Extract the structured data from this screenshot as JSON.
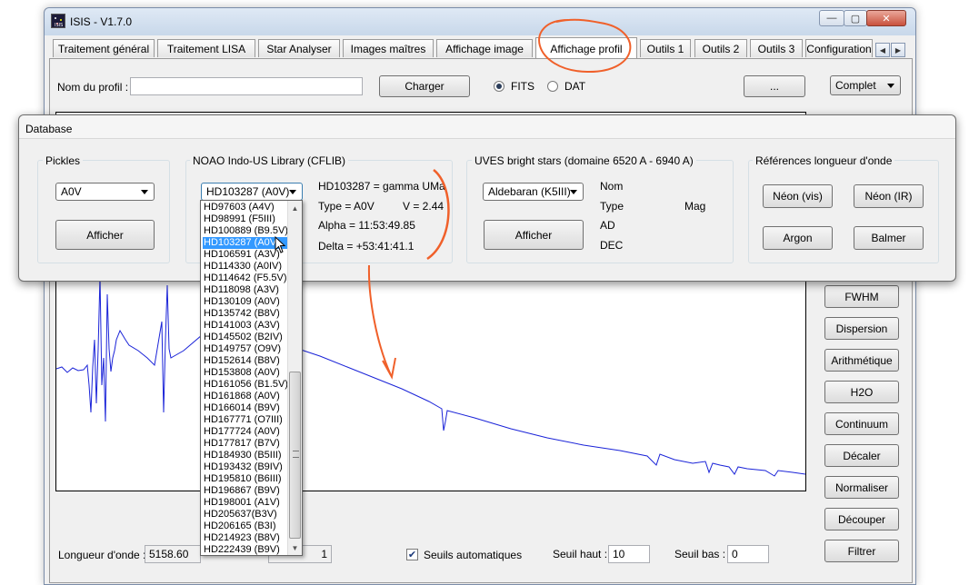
{
  "window": {
    "title": "ISIS - V1.7.0",
    "icon": "isis-app-icon",
    "controls": [
      "—",
      "▢",
      "✕"
    ]
  },
  "tabs": [
    {
      "label": "Traitement général",
      "active": false
    },
    {
      "label": "Traitement LISA",
      "active": false
    },
    {
      "label": "Star Analyser",
      "active": false
    },
    {
      "label": "Images maîtres",
      "active": false
    },
    {
      "label": "Affichage image",
      "active": false
    },
    {
      "label": "Affichage profil",
      "active": true
    },
    {
      "label": "Outils 1",
      "active": false
    },
    {
      "label": "Outils 2",
      "active": false
    },
    {
      "label": "Outils 3",
      "active": false
    },
    {
      "label": "Configuration",
      "active": false
    }
  ],
  "tab_scroll": {
    "left": "◀",
    "right": "▶"
  },
  "profile": {
    "name_label": "Nom du profil :",
    "name_value": "",
    "load_button": "Charger",
    "format_fits": "FITS",
    "format_dat": "DAT",
    "selected_format": "FITS",
    "browse_button": "...",
    "mode_value": "Complet"
  },
  "side_buttons": [
    "FWHM",
    "Dispersion",
    "Arithmétique",
    "H2O",
    "Continuum",
    "Décaler",
    "Normaliser",
    "Découper",
    "Filtrer"
  ],
  "bottom": {
    "wavelength_label": "Longueur d'onde :",
    "wavelength_value": "5158.60",
    "second_value": "1",
    "auto_thresholds_label": "Seuils automatiques",
    "auto_thresholds_checked": true,
    "high_label": "Seuil haut :",
    "high_value": "10",
    "low_label": "Seuil bas :",
    "low_value": "0"
  },
  "database": {
    "title": "Database",
    "pickles": {
      "title": "Pickles",
      "selected": "A0V",
      "show_button": "Afficher"
    },
    "noao": {
      "title": "NOAO Indo-US Library (CFLIB)",
      "selected": "HD103287 (A0V)",
      "star_name": "HD103287 = gamma UMa",
      "type": "Type = A0V",
      "magnitude": "V = 2.44",
      "alpha": "Alpha = 11:53:49.85",
      "delta": "Delta = +53:41:41.1",
      "list": [
        "HD97603 (A4V)",
        "HD98991 (F5III)",
        "HD100889 (B9.5V)",
        "HD103287 (A0V)",
        "HD106591 (A3V)",
        "HD114330 (A0IV)",
        "HD114642 (F5.5V)",
        "HD118098 (A3V)",
        "HD130109 (A0V)",
        "HD135742 (B8V)",
        "HD141003 (A3V)",
        "HD145502 (B2IV)",
        "HD149757 (O9V)",
        "HD152614 (B8V)",
        "HD153808 (A0V)",
        "HD161056 (B1.5V)",
        "HD161868 (A0V)",
        "HD166014 (B9V)",
        "HD167771 (O7III)",
        "HD177724 (A0V)",
        "HD177817 (B7V)",
        "HD184930 (B5III)",
        "HD193432 (B9IV)",
        "HD195810 (B6III)",
        "HD196867 (B9V)",
        "HD198001 (A1V)",
        "HD205637(B3V)",
        "HD206165 (B3I)",
        "HD214923 (B8V)",
        "HD222439 (B9V)"
      ],
      "selected_index": 3
    },
    "uves": {
      "title": "UVES bright stars (domaine 6520 A - 6940 A)",
      "selected": "Aldebaran (K5III)",
      "show_button": "Afficher",
      "nom_label": "Nom",
      "type_label": "Type",
      "mag_label": "Mag",
      "ad_label": "AD",
      "dec_label": "DEC"
    },
    "refs": {
      "title": "Références longueur d'onde",
      "neon_vis": "Néon (vis)",
      "neon_ir": "Néon (IR)",
      "argon": "Argon",
      "balmer": "Balmer"
    }
  },
  "colors": {
    "spectrum": "#1a23d8",
    "annotation": "#f0602a",
    "selection": "#3399ff"
  }
}
